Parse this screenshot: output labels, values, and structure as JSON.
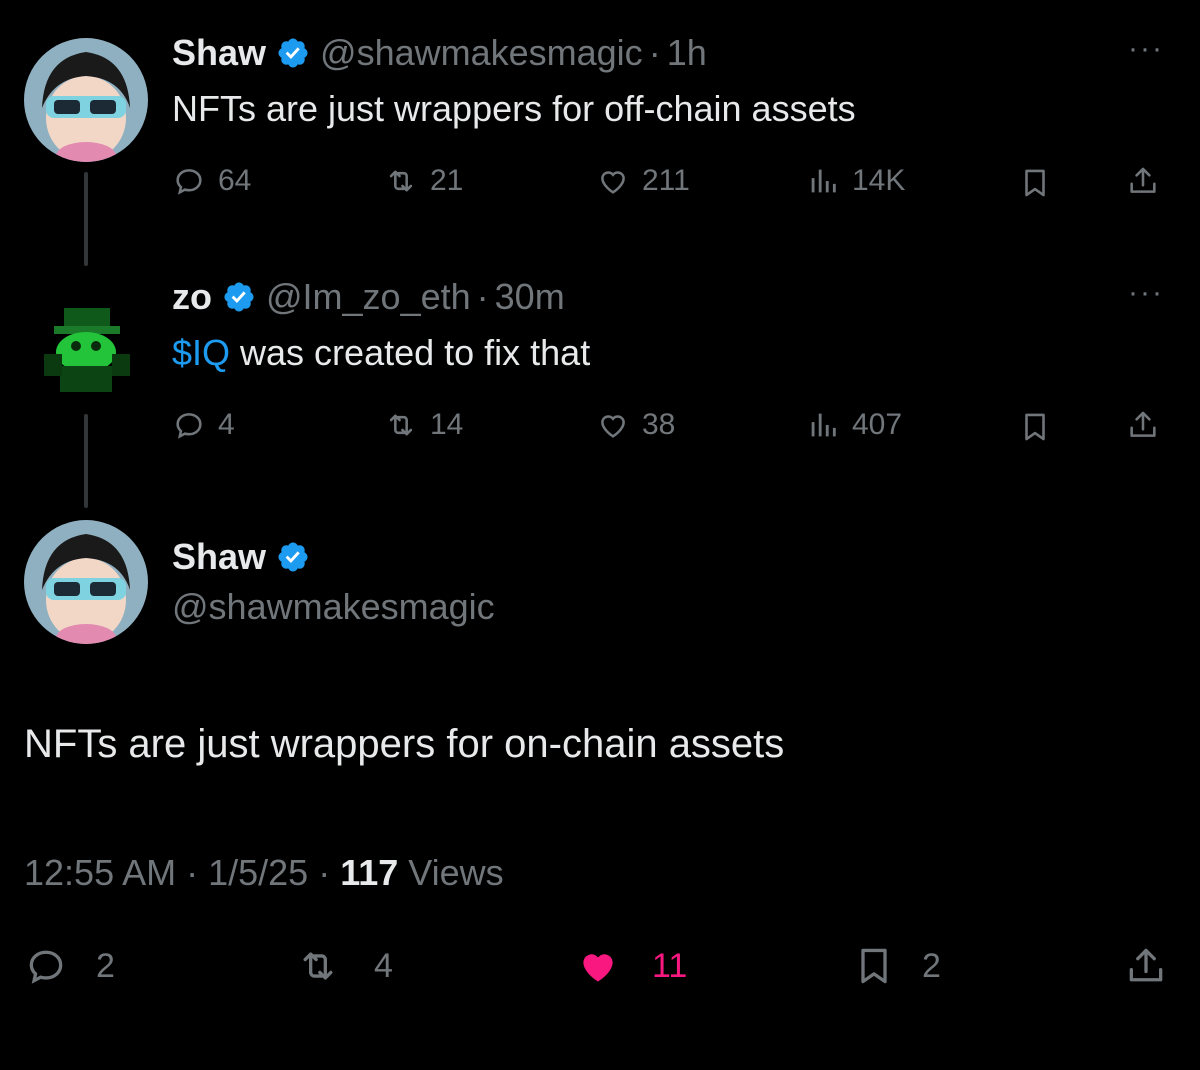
{
  "tweet1": {
    "name": "Shaw",
    "handle": "@shawmakesmagic",
    "sep": "·",
    "time": "1h",
    "text": "NFTs are just wrappers for off-chain assets",
    "replies": "64",
    "retweets": "21",
    "likes": "211",
    "views": "14K",
    "more": "···"
  },
  "tweet2": {
    "name": "zo",
    "handle": "@Im_zo_eth",
    "sep": "·",
    "time": "30m",
    "cashtag": "$IQ",
    "text": " was created to fix that",
    "replies": "4",
    "retweets": "14",
    "likes": "38",
    "views": "407",
    "more": "···"
  },
  "main": {
    "name": "Shaw",
    "handle": "@shawmakesmagic",
    "text": "NFTs are just wrappers for on-chain assets",
    "time": "12:55 AM",
    "sep1": " · ",
    "date": "1/5/25",
    "sep2": " · ",
    "views_count": "117",
    "views_label": " Views",
    "replies": "2",
    "retweets": "4",
    "likes": "11",
    "bookmarks": "2"
  },
  "colors": {
    "background": "#000000",
    "verified": "#1d9bf0",
    "like_active": "#f91880",
    "muted": "#71767b"
  },
  "icons": [
    "reply-icon",
    "retweet-icon",
    "like-icon",
    "views-icon",
    "bookmark-icon",
    "share-icon",
    "verified-icon",
    "more-icon"
  ]
}
